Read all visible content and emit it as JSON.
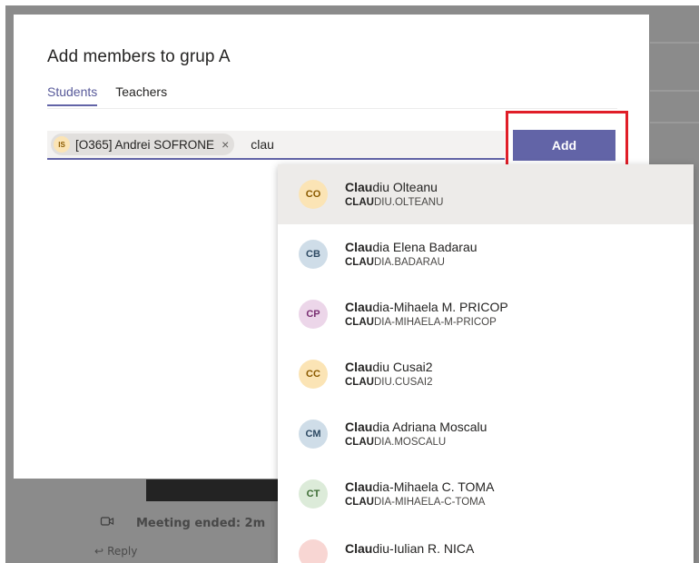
{
  "dialog": {
    "title": "Add members to grup A",
    "tabs": [
      {
        "label": "Students",
        "active": true
      },
      {
        "label": "Teachers",
        "active": false
      }
    ],
    "selected_chip": {
      "initials": "IS",
      "label": "[O365] Andrei SOFRONE",
      "remove_glyph": "×"
    },
    "search_text": "clau",
    "add_label": "Add"
  },
  "suggestions": {
    "query_bold_name": "Clau",
    "query_bold_sub": "CLAU",
    "items": [
      {
        "initials": "CO",
        "name_rest": "diu Olteanu",
        "sub_rest": "DIU.OLTEANU",
        "avatar_bg": "#fbe4b5",
        "avatar_fg": "#8a5a00"
      },
      {
        "initials": "CB",
        "name_rest": "dia Elena Badarau",
        "sub_rest": "DIA.BADARAU",
        "avatar_bg": "#cfdde8",
        "avatar_fg": "#2e4a63"
      },
      {
        "initials": "CP",
        "name_rest": "dia-Mihaela M. PRICOP",
        "sub_rest": "DIA-MIHAELA-M-PRICOP",
        "avatar_bg": "#ecd6e9",
        "avatar_fg": "#7a2f72"
      },
      {
        "initials": "CC",
        "name_rest": "diu Cusai2",
        "sub_rest": "DIU.CUSAI2",
        "avatar_bg": "#fbe4b5",
        "avatar_fg": "#8a5a00"
      },
      {
        "initials": "CM",
        "name_rest": "dia Adriana Moscalu",
        "sub_rest": "DIA.MOSCALU",
        "avatar_bg": "#cfdde8",
        "avatar_fg": "#2e4a63"
      },
      {
        "initials": "CT",
        "name_rest": "dia-Mihaela C. TOMA",
        "sub_rest": "DIA-MIHAELA-C-TOMA",
        "avatar_bg": "#dcebd9",
        "avatar_fg": "#3b6b33"
      },
      {
        "initials": "",
        "name_rest": "diu-Iulian R. NICA",
        "sub_rest": "",
        "avatar_bg": "#f8d6d3",
        "avatar_fg": "#a4262c"
      }
    ]
  },
  "background": {
    "meeting_text": "Meeting ended: 2m",
    "reply_text": "Reply"
  },
  "colors": {
    "accent": "#6264a7",
    "highlight": "#e01e28"
  }
}
